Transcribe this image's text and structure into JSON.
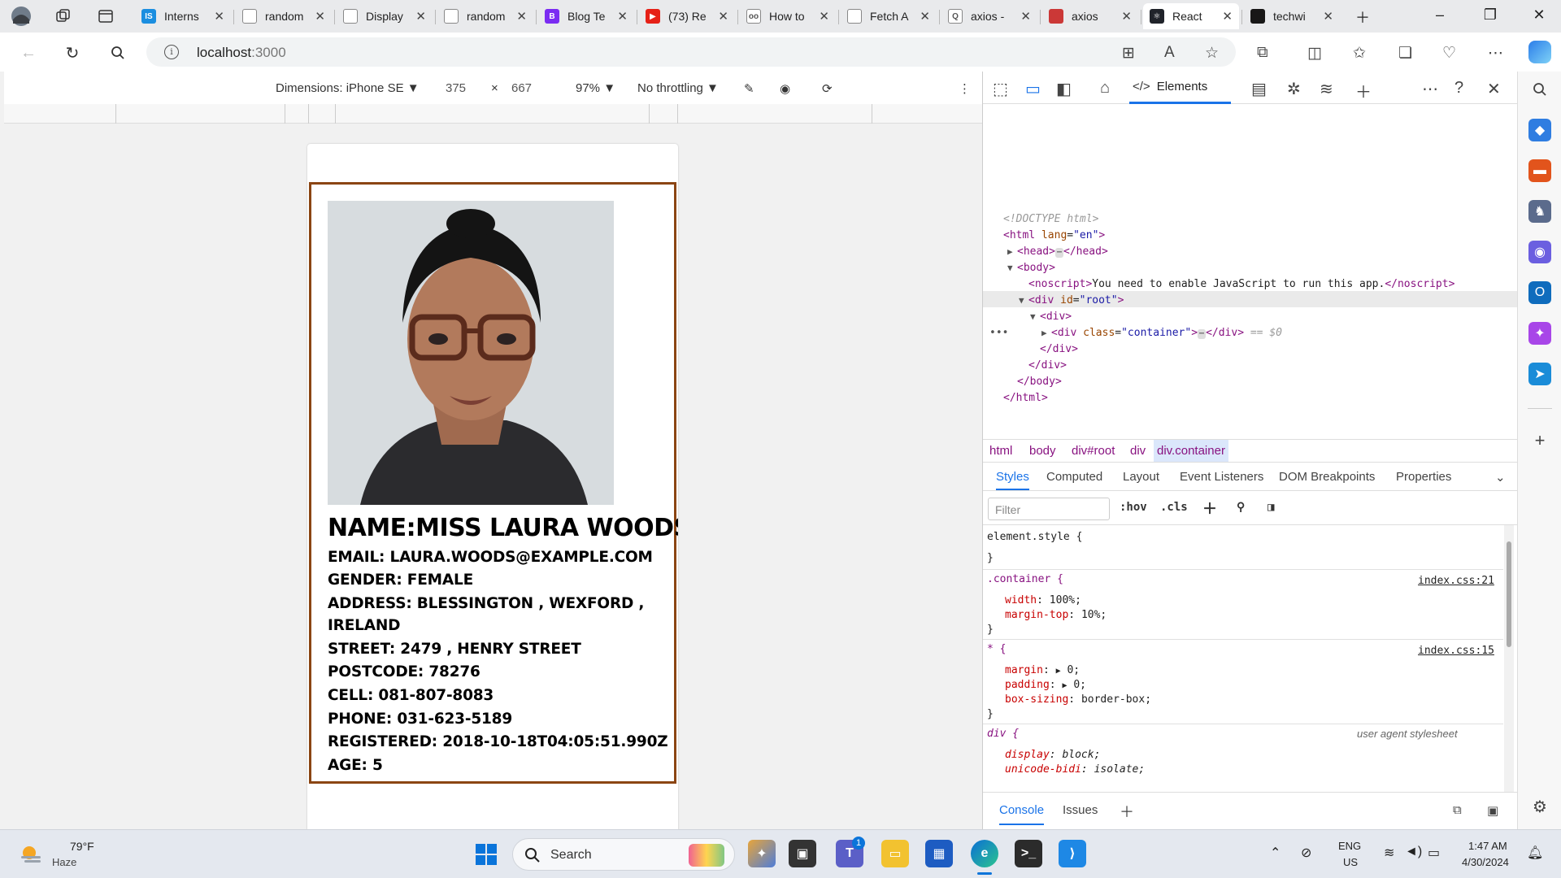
{
  "browser": {
    "tabs": [
      {
        "title": "Interns",
        "fav_bg": "#1b8ee0",
        "fav": "IS"
      },
      {
        "title": "random",
        "fav_bg": "#ffffff",
        "fav": ""
      },
      {
        "title": "Display",
        "fav_bg": "#ffffff",
        "fav": ""
      },
      {
        "title": "random",
        "fav_bg": "#ffffff",
        "fav": ""
      },
      {
        "title": "Blog Te",
        "fav_bg": "#7b2cf2",
        "fav": "B"
      },
      {
        "title": "(73) Re",
        "fav_bg": "#e62117",
        "fav": "▶"
      },
      {
        "title": "How to",
        "fav_bg": "#ffffff",
        "fav": "oo"
      },
      {
        "title": "Fetch A",
        "fav_bg": "#ffffff",
        "fav": ""
      },
      {
        "title": "axios -",
        "fav_bg": "#ffffff",
        "fav": "Q"
      },
      {
        "title": "axios",
        "fav_bg": "#cb3837",
        "fav": ""
      },
      {
        "title": "React",
        "fav_bg": "#20232a",
        "fav": "⚛"
      },
      {
        "title": "techwi",
        "fav_bg": "#181717",
        "fav": ""
      }
    ],
    "active_tab_index": 10,
    "url_host": "localhost",
    "url_port": ":3000"
  },
  "device_toolbar": {
    "dimensions_label": "Dimensions: iPhone SE",
    "width": "375",
    "times": "×",
    "height": "667",
    "zoom": "97%",
    "throttling": "No throttling"
  },
  "profile": {
    "name": "NAME:MISS LAURA WOODS",
    "fields": [
      "EMAIL: LAURA.WOODS@EXAMPLE.COM",
      "GENDER: FEMALE",
      "ADDRESS: BLESSINGTON , WEXFORD ,",
      "IRELAND",
      "STREET: 2479 , HENRY STREET",
      "POSTCODE: 78276",
      "CELL: 081-807-8083",
      "PHONE: 031-623-5189",
      "REGISTERED: 2018-10-18T04:05:51.990Z",
      "AGE: 5"
    ]
  },
  "devtools": {
    "elements_tab": "Elements",
    "dom": {
      "doctype": "<!DOCTYPE html>",
      "html_open_tag": "<html",
      "lang_attr": "lang",
      "lang_val": "\"en\"",
      "head": "<head>",
      "head_close": "</head>",
      "body": "<body>",
      "noscript_open": "<noscript>",
      "noscript_text": "You need to enable JavaScript to run this app.",
      "noscript_close": "</noscript>",
      "div_root_open": "<div",
      "id_attr": "id",
      "id_val": "\"root\"",
      "div_open": "<div>",
      "container_open": "<div",
      "class_attr": "class",
      "class_val": "\"container\"",
      "div_close": "</div>",
      "eq": "== $0",
      "body_close": "</body>",
      "html_close": "</html>"
    },
    "breadcrumbs": [
      "html",
      "body",
      "div#root",
      "div",
      "div.container"
    ],
    "subtabs": [
      "Styles",
      "Computed",
      "Layout",
      "Event Listeners",
      "DOM Breakpoints",
      "Properties"
    ],
    "filter_placeholder": "Filter",
    "hov": ":hov",
    "cls": ".cls",
    "styles": {
      "element_style": "element.style {",
      "close": "}",
      "container_sel": ".container {",
      "container_link": "index.css:21",
      "width_prop": "width",
      "width_val": "100%;",
      "margin_top_prop": "margin-top",
      "margin_top_val": "10%;",
      "star_sel": "* {",
      "star_link": "index.css:15",
      "margin_prop": "margin",
      "margin_val": "0;",
      "padding_prop": "padding",
      "padding_val": "0;",
      "box_sizing_prop": "box-sizing",
      "box_sizing_val": "border-box;",
      "div_sel": "div {",
      "ua_label": "user agent stylesheet",
      "display_prop": "display",
      "display_val": "block;",
      "unicode_prop": "unicode-bidi",
      "unicode_val": "isolate;"
    },
    "drawer_tabs": [
      "Console",
      "Issues"
    ]
  },
  "taskbar": {
    "weather_temp": "79°F",
    "weather_desc": "Haze",
    "search_label": "Search",
    "lang": "ENG",
    "region": "US",
    "time": "1:47 AM",
    "date": "4/30/2024",
    "teams_badge": "1"
  },
  "colors": {
    "card_border": "#8b4513",
    "accent": "#1a73e8"
  }
}
